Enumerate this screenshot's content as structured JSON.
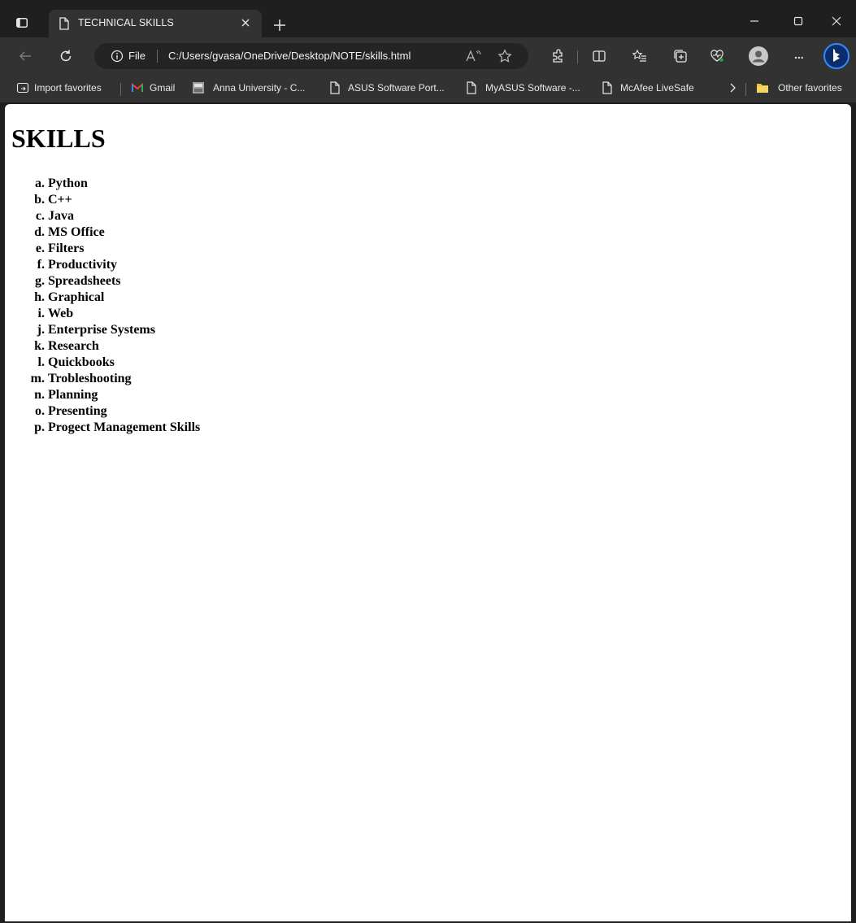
{
  "browser": {
    "tab_title": "TECHNICAL SKILLS",
    "address": {
      "scheme_label": "File",
      "url": "C:/Users/gvasa/OneDrive/Desktop/NOTE/skills.html"
    },
    "bookmarks": [
      {
        "label": "Import favorites",
        "icon": "import-icon"
      },
      {
        "label": "Gmail",
        "icon": "gmail-icon"
      },
      {
        "label": "Anna University - C...",
        "icon": "site-icon"
      },
      {
        "label": "ASUS Software Port...",
        "icon": "page-icon"
      },
      {
        "label": "MyASUS Software -...",
        "icon": "page-icon"
      },
      {
        "label": "McAfee LiveSafe",
        "icon": "page-icon"
      }
    ],
    "other_favorites": "Other favorites",
    "more_label": "..."
  },
  "page": {
    "heading": "SKILLS",
    "skills": [
      "Python",
      "C++",
      "Java",
      "MS Office",
      "Filters",
      "Productivity",
      "Spreadsheets",
      "Graphical",
      "Web",
      "Enterprise Systems",
      "Research",
      "Quickbooks",
      "Trobleshooting",
      "Planning",
      "Presenting",
      "Progect Management Skills"
    ]
  },
  "colors": {
    "chrome_dark": "#1f1f1f",
    "toolbar": "#323232",
    "page_bg": "#ffffff",
    "bing_blue": "#1a73e8"
  }
}
